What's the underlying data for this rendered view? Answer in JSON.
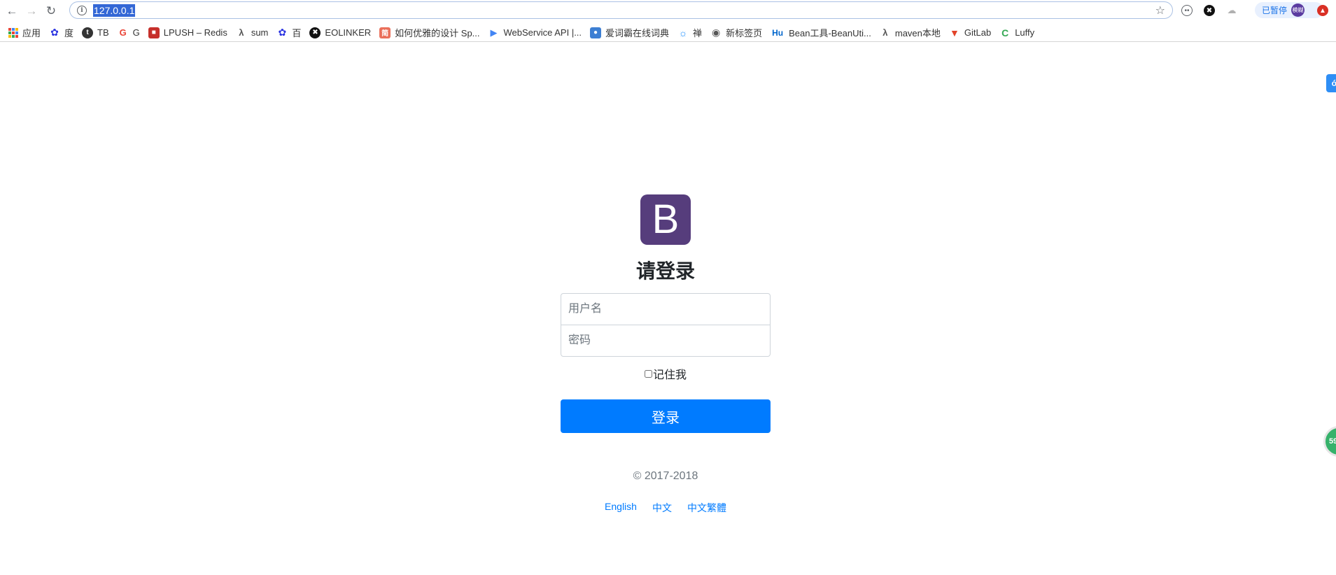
{
  "browser": {
    "url": "127.0.0.1",
    "paused_label": "已暂停",
    "avatar_text": "模糊",
    "extensions": [
      "ghost-extension-icon",
      "eolinker-extension-icon",
      "cloud-extension-icon"
    ]
  },
  "bookmarks": [
    {
      "label": "应用",
      "icon": "apps-grid-icon"
    },
    {
      "label": "度",
      "icon": "baidu-paw-icon",
      "color": "#2932e1"
    },
    {
      "label": "TB",
      "icon": "t-circle-icon",
      "color": "#333333"
    },
    {
      "label": "G",
      "icon": "google-g-icon",
      "color": "#ea4335"
    },
    {
      "label": "LPUSH – Redis",
      "icon": "redis-cube-icon",
      "color": "#c6302b"
    },
    {
      "label": "sum",
      "icon": "lambda-icon",
      "color": "#555555"
    },
    {
      "label": "百",
      "icon": "baidu-paw-icon",
      "color": "#2932e1"
    },
    {
      "label": "EOLINKER",
      "icon": "eolinker-icon",
      "color": "#111111"
    },
    {
      "label": "如何优雅的设计 Sp...",
      "icon": "jian-icon",
      "color": "#ea6f5a"
    },
    {
      "label": "WebService API |...",
      "icon": "play-arrow-icon",
      "color": "#4285f4"
    },
    {
      "label": "爱词霸在线词典",
      "icon": "iciba-icon",
      "color": "#3d7fd3"
    },
    {
      "label": "禅",
      "icon": "zen-spiral-icon",
      "color": "#1e90ff"
    },
    {
      "label": "新标签页",
      "icon": "globe-icon",
      "color": "#555555"
    },
    {
      "label": "Bean工具-BeanUti...",
      "icon": "hu-icon",
      "color": "#0066cc"
    },
    {
      "label": "maven本地",
      "icon": "lambda-icon",
      "color": "#555555"
    },
    {
      "label": "GitLab",
      "icon": "gitlab-fox-icon",
      "color": "#e24329"
    },
    {
      "label": "Luffy",
      "icon": "c-circle-icon",
      "color": "#34a853"
    }
  ],
  "signin": {
    "logo_letter": "B",
    "heading": "请登录",
    "username_placeholder": "用户名",
    "password_placeholder": "密码",
    "remember_label": "记住我",
    "submit_label": "登录",
    "copyright": "© 2017-2018",
    "languages": [
      "English",
      "中文",
      "中文繁體"
    ]
  },
  "floating": {
    "side_tab_glyph": "ó",
    "speed_ball_text": "59"
  },
  "colors": {
    "brand": "#563d7c",
    "primary": "#007bff",
    "url_selection": "#3367d6"
  }
}
